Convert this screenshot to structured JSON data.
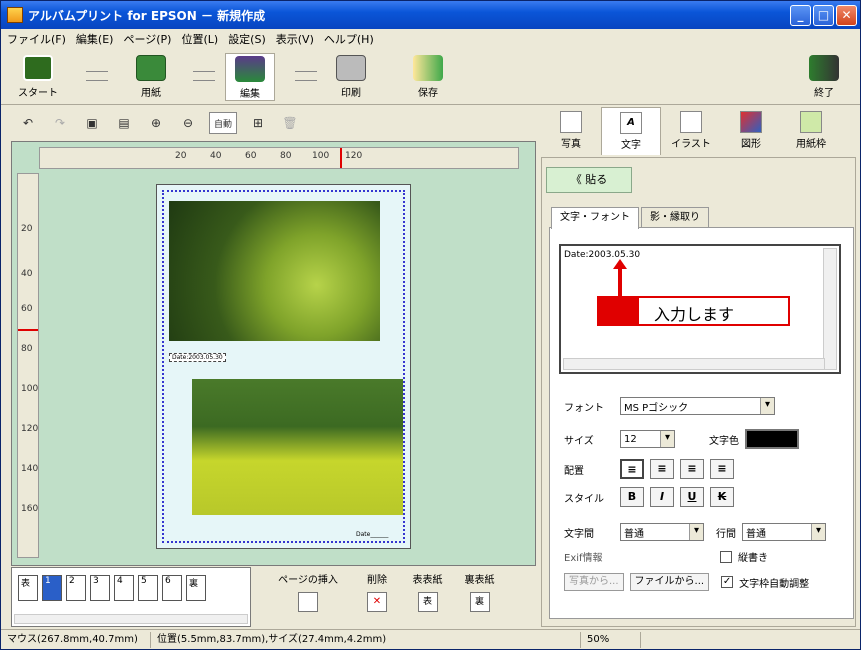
{
  "window": {
    "title": "アルバムプリント for EPSON － 新規作成"
  },
  "menu": [
    "ファイル(F)",
    "編集(E)",
    "ページ(P)",
    "位置(L)",
    "設定(S)",
    "表示(V)",
    "ヘルプ(H)"
  ],
  "mainbar": {
    "start": "スタート",
    "paper": "用紙",
    "edit": "編集",
    "print": "印刷",
    "save": "保存",
    "exit": "終了"
  },
  "toolbar": {
    "auto_label": "自動"
  },
  "ruler_h": [
    "20",
    "40",
    "60",
    "80",
    "100",
    "120"
  ],
  "ruler_v": [
    "20",
    "40",
    "60",
    "80",
    "100",
    "120",
    "140",
    "160"
  ],
  "page_texts": {
    "date_field": "Date:2003.05.30",
    "date_small": "Date______"
  },
  "pages": [
    "表",
    "1",
    "2",
    "3",
    "4",
    "5",
    "6",
    "裏"
  ],
  "page_buttons": {
    "insert": "ページの挿入",
    "delete": "削除",
    "front": "表表紙",
    "back": "裏表紙",
    "front_icon": "表",
    "back_icon": "裏"
  },
  "status": {
    "mouse": "マウス(267.8mm,40.7mm)",
    "position": "位置(5.5mm,83.7mm),サイズ(27.4mm,4.2mm)",
    "zoom": "50%"
  },
  "right_tabs": [
    "写真",
    "文字",
    "イラスト",
    "図形",
    "用紙枠"
  ],
  "panel": {
    "paste": "《 貼る",
    "subtab1": "文字・フォント",
    "subtab2": "影・縁取り",
    "text_value": "Date:2003.05.30",
    "callout": "入力します",
    "font_label": "フォント",
    "font_value": "MS Pゴシック",
    "size_label": "サイズ",
    "size_value": "12",
    "color_label": "文字色",
    "align_label": "配置",
    "style_label": "スタイル",
    "style_bold": "B",
    "style_italic": "I",
    "style_underline": "U",
    "style_strike": "K",
    "char_spacing_label": "文字間",
    "char_spacing_value": "普通",
    "line_spacing_label": "行間",
    "line_spacing_value": "普通",
    "exif_label": "Exif情報",
    "vertical_label": "縦書き",
    "from_photo": "写真から...",
    "from_file": "ファイルから...",
    "autofit_label": "文字枠自動調整"
  },
  "colors": {
    "text_color": "#000000",
    "canvas_bg": "#c0dfc8",
    "accent": "#e00000"
  }
}
